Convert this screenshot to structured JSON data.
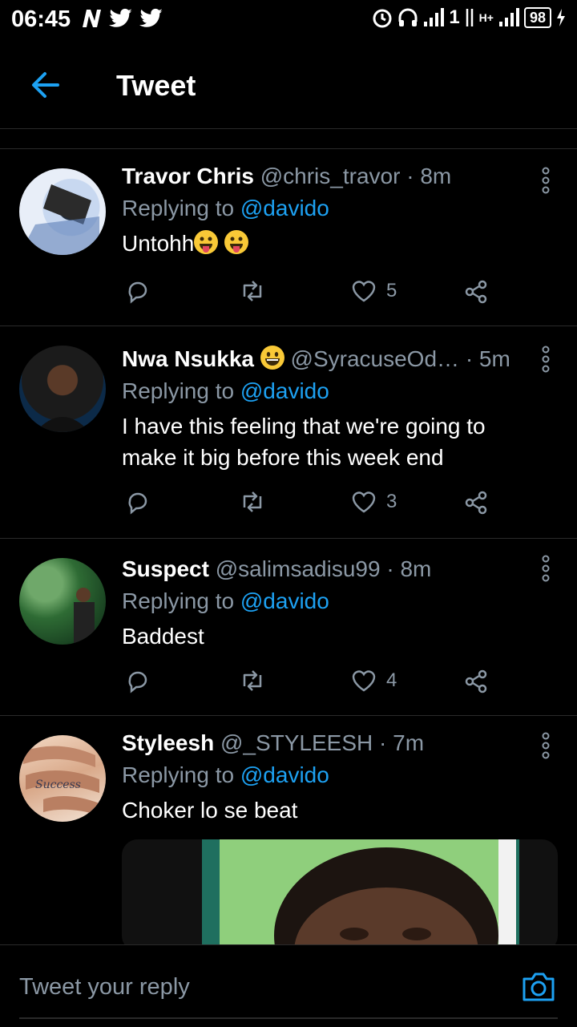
{
  "status_bar": {
    "time": "06:45",
    "network_left": "H+",
    "network_right": "1",
    "battery": "98"
  },
  "header": {
    "title": "Tweet",
    "back_icon": "arrow-left-icon"
  },
  "colors": {
    "accent": "#1da1f2",
    "muted": "#8b98a5",
    "background": "#000000"
  },
  "tweets": [
    {
      "name": "Travor Chris",
      "handle": "@chris_travor",
      "sep": "·",
      "time": "8m",
      "replying": "Replying to",
      "mention": "@davido",
      "text": "Untohh",
      "emoji_count": 2,
      "likes": "5"
    },
    {
      "name": "Nwa Nsukka",
      "handle": "@SyracuseOd…",
      "sep": "·",
      "time": "5m",
      "replying": "Replying to",
      "mention": "@davido",
      "text": "I have this feeling that we're going to make it big before this week end",
      "likes": "3"
    },
    {
      "name": "Suspect",
      "handle": "@salimsadisu99",
      "sep": "·",
      "time": "8m",
      "replying": "Replying to",
      "mention": "@davido",
      "text": "Baddest",
      "likes": "4"
    },
    {
      "name": "Styleesh",
      "handle": "@_STYLEESH",
      "sep": "·",
      "time": "7m",
      "replying": "Replying to",
      "mention": "@davido",
      "text": "Choker lo se beat"
    }
  ],
  "reply_bar": {
    "placeholder": "Tweet your reply",
    "camera_icon": "camera-icon"
  }
}
